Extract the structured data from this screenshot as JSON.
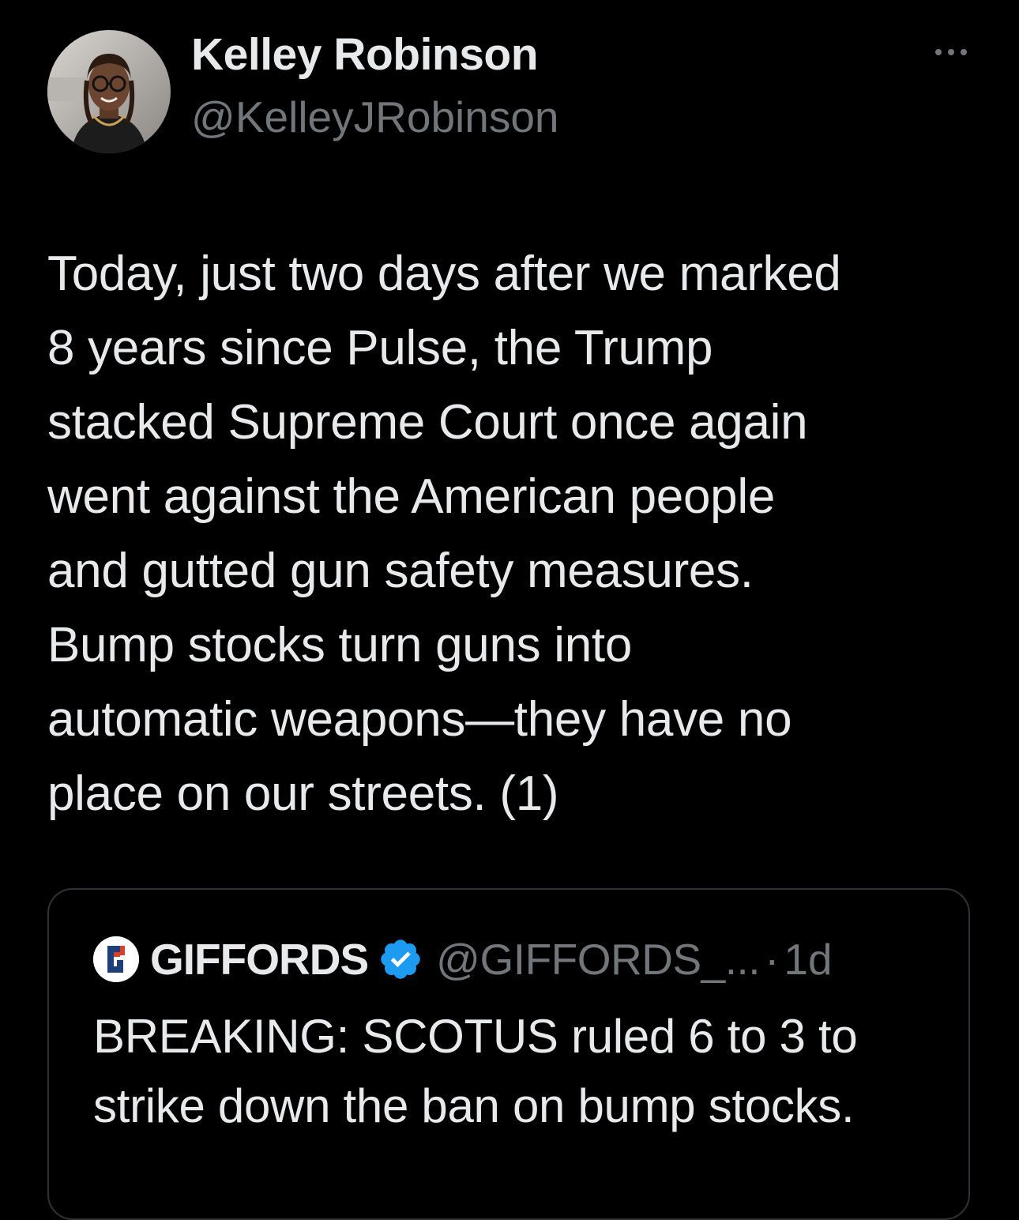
{
  "tweet": {
    "author": {
      "display_name": "Kelley Robinson",
      "handle": "@KelleyJRobinson",
      "avatar_icon": "profile-photo"
    },
    "more_icon": "more-horizontal-icon",
    "text": "Today, just two days after we marked\n8 years since Pulse, the Trump\nstacked Supreme Court once again\nwent against the American people\nand gutted gun safety measures.\nBump stocks turn guns into\nautomatic weapons—they have no\nplace on our streets. (1)"
  },
  "quoted_tweet": {
    "avatar_icon": "giffords-logo",
    "display_name": "GIFFORDS",
    "verified_icon": "verified-badge-icon",
    "handle": "@GIFFORDS_...",
    "separator": "·",
    "time": "1d",
    "text": "BREAKING: SCOTUS ruled 6 to 3 to\nstrike down the ban on bump stocks."
  },
  "colors": {
    "background": "#000000",
    "primary_text": "#e7e9ea",
    "secondary_text": "#71767b",
    "border": "#2f3336",
    "verified_blue": "#1d9bf0"
  }
}
